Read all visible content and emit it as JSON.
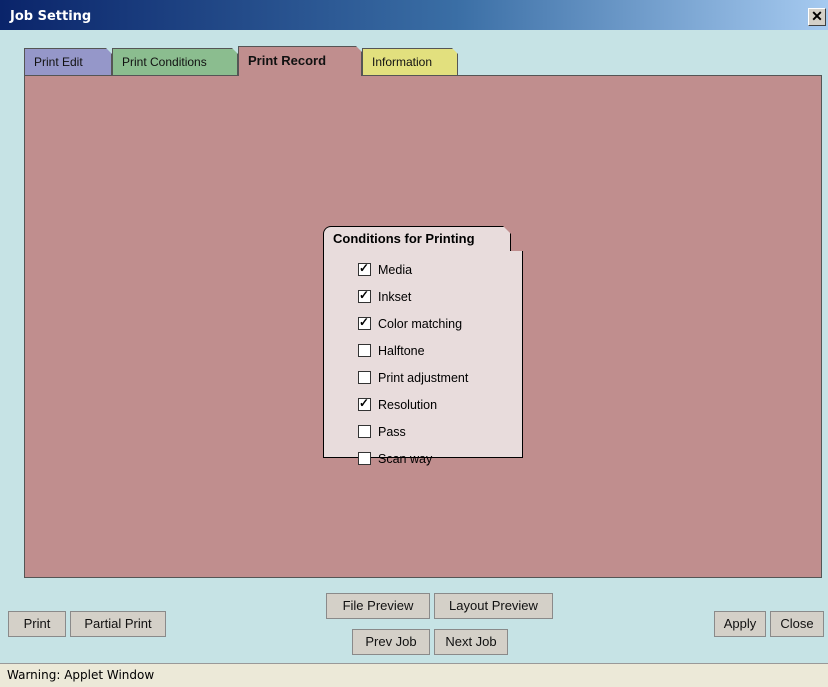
{
  "window": {
    "title": "Job Setting",
    "close_glyph": "✕"
  },
  "tabs": [
    {
      "label": "Print Edit",
      "color": "#9597c9",
      "active": false
    },
    {
      "label": "Print Conditions",
      "color": "#8bbd8f",
      "active": false
    },
    {
      "label": "Print Record",
      "color": "#c08e8e",
      "active": true
    },
    {
      "label": "Information",
      "color": "#e2e07e",
      "active": false
    }
  ],
  "panel": {
    "background": "#c08e8e"
  },
  "conditions": {
    "title": "Conditions for Printing",
    "items": [
      {
        "label": "Media",
        "checked": true
      },
      {
        "label": "Inkset",
        "checked": true
      },
      {
        "label": "Color matching",
        "checked": true
      },
      {
        "label": "Halftone",
        "checked": false
      },
      {
        "label": "Print adjustment",
        "checked": false
      },
      {
        "label": "Resolution",
        "checked": true
      },
      {
        "label": "Pass",
        "checked": false
      },
      {
        "label": "Scan way",
        "checked": false
      }
    ]
  },
  "buttons": {
    "print": "Print",
    "partial_print": "Partial Print",
    "file_preview": "File Preview",
    "layout_preview": "Layout Preview",
    "prev_job": "Prev Job",
    "next_job": "Next Job",
    "apply": "Apply",
    "close": "Close"
  },
  "status": {
    "text": "Warning: Applet Window"
  }
}
